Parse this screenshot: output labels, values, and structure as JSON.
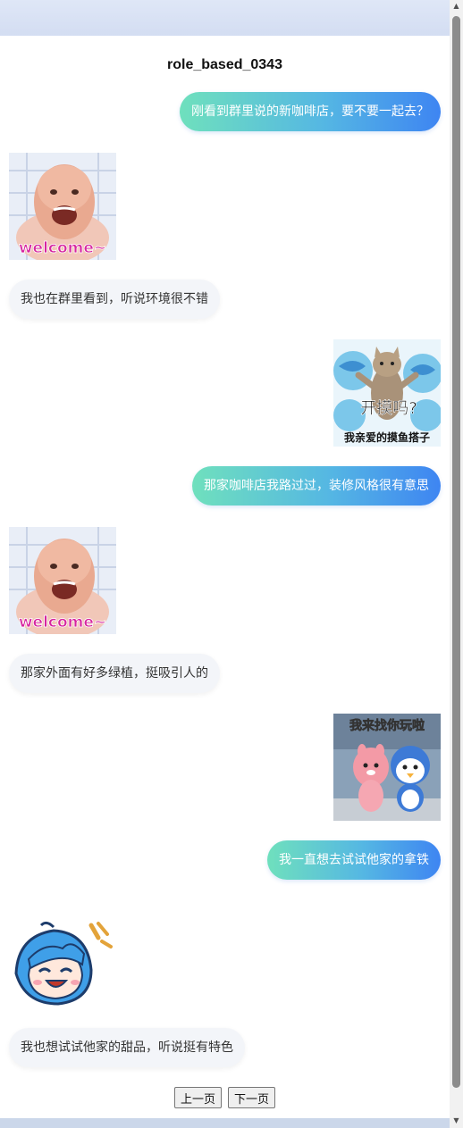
{
  "title": "role_based_0343",
  "messages": [
    {
      "side": "right",
      "type": "text",
      "text": "刚看到群里说的新咖啡店，要不要一起去？"
    },
    {
      "side": "left",
      "type": "sticker",
      "icon": "welcome-baby-sticker",
      "caption": "welcome~"
    },
    {
      "side": "left",
      "type": "text",
      "text": "我也在群里看到，听说环境很不错"
    },
    {
      "side": "right",
      "type": "sticker",
      "icon": "cat-fish-sticker",
      "caption": "开摸吗?",
      "subcaption": "我亲爱的摸鱼搭子"
    },
    {
      "side": "right",
      "type": "text",
      "text": "那家咖啡店我路过过，装修风格很有意思"
    },
    {
      "side": "left",
      "type": "sticker",
      "icon": "welcome-baby-sticker",
      "caption": "welcome~"
    },
    {
      "side": "left",
      "type": "text",
      "text": "那家外面有好多绿植，挺吸引人的"
    },
    {
      "side": "right",
      "type": "sticker",
      "icon": "pororo-sticker",
      "caption": "我来找你玩啦"
    },
    {
      "side": "right",
      "type": "text",
      "text": "我一直想去试试他家的拿铁"
    },
    {
      "side": "left",
      "type": "sticker",
      "icon": "blue-hair-girl-laugh-sticker"
    },
    {
      "side": "left",
      "type": "text",
      "text": "我也想试试他家的甜品，听说挺有特色"
    }
  ],
  "pager": {
    "prev": "上一页",
    "next": "下一页"
  },
  "colors": {
    "outgoing_start": "#6fe0bd",
    "outgoing_end": "#3e85f2",
    "incoming_bg": "#f3f5f9",
    "header_band": "#dfe7f7"
  }
}
